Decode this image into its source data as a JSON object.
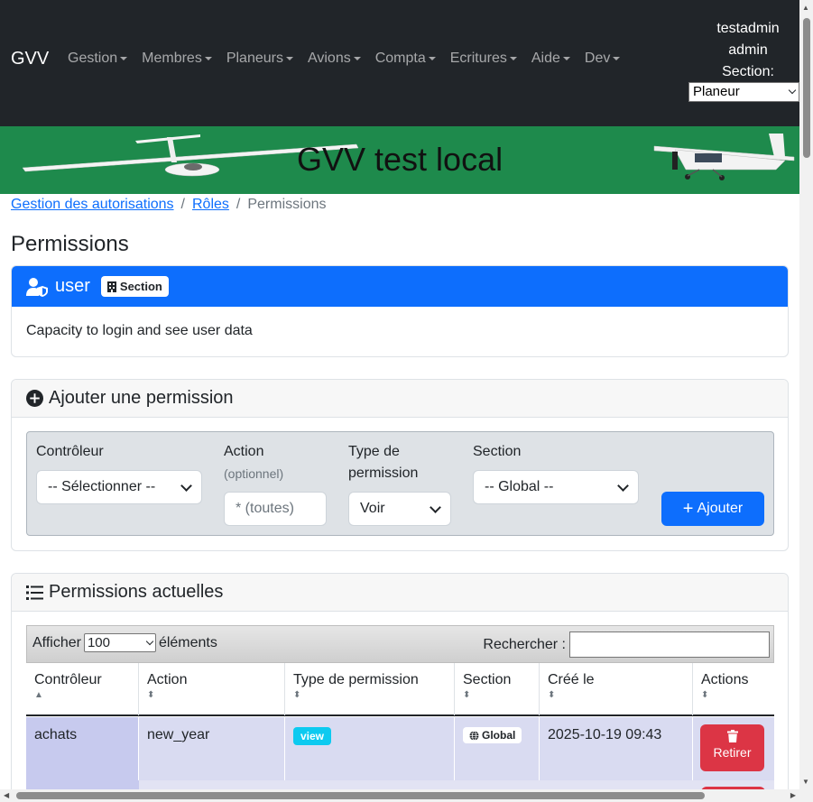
{
  "navbar": {
    "brand": "GVV",
    "items": [
      "Gestion",
      "Membres",
      "Planeurs",
      "Avions",
      "Compta",
      "Ecritures",
      "Aide",
      "Dev"
    ],
    "user_line1": "testadmin",
    "user_line2": "admin",
    "section_label": "Section:",
    "section_value": "Planeur"
  },
  "banner": {
    "title": "GVV test local"
  },
  "breadcrumb": {
    "item1": "Gestion des autorisations",
    "item2": "Rôles",
    "current": "Permissions",
    "separator": "/"
  },
  "page_title": "Permissions",
  "role": {
    "name": "user",
    "badge": "Section",
    "description": "Capacity to login and see user data",
    "header_color": "#0d6efd"
  },
  "add_form": {
    "title": "Ajouter une permission",
    "controller_label": "Contrôleur",
    "controller_value": "-- Sélectionner --",
    "action_label": "Action",
    "action_sub": "(optionnel)",
    "action_placeholder": "* (toutes)",
    "type_label_1": "Type de",
    "type_label_2": "permission",
    "type_value": "Voir",
    "section_label": "Section",
    "section_value": "-- Global --",
    "add_button": "Ajouter"
  },
  "perm_list": {
    "title": "Permissions actuelles",
    "length_prefix": "Afficher",
    "length_value": "100",
    "length_suffix": "éléments",
    "search_label": "Rechercher :",
    "columns": [
      "Contrôleur",
      "Action",
      "Type de permission",
      "Section",
      "Créé le",
      "Actions"
    ],
    "rows": [
      {
        "controller": "achats",
        "action": "new_year",
        "type": "view",
        "section": "Global",
        "created": "2025-10-19 09:43",
        "button": "Retirer"
      }
    ]
  },
  "colors": {
    "navbar": "#212529",
    "banner": "#1e8a4c",
    "primary": "#0d6efd",
    "danger": "#dc3545",
    "info": "#0dcaf0"
  }
}
